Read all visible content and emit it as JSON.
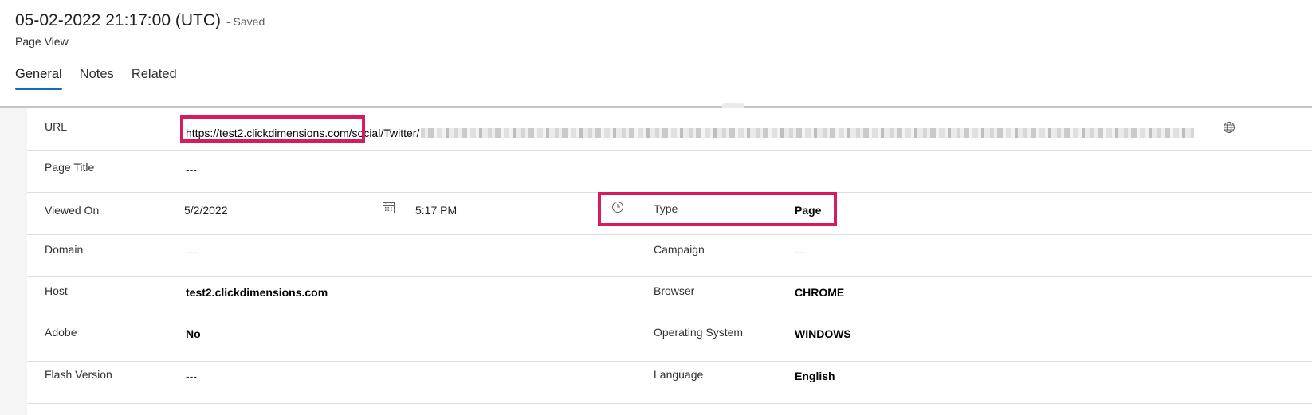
{
  "header": {
    "title": "05-02-2022 21:17:00 (UTC)",
    "saved_status": "- Saved",
    "entity_type": "Page View"
  },
  "tabs": [
    {
      "label": "General",
      "active": true
    },
    {
      "label": "Notes",
      "active": false
    },
    {
      "label": "Related",
      "active": false
    }
  ],
  "fields": {
    "url": {
      "label": "URL",
      "value": "https://test2.clickdimensions.com/social/Twitter/",
      "visible_prefix": "https://test2.clickdimensions.com/",
      "visible_suffix": "social/Twitter/"
    },
    "page_title": {
      "label": "Page Title",
      "value": "---"
    },
    "viewed_on": {
      "label": "Viewed On",
      "date": "5/2/2022",
      "time": "5:17 PM"
    },
    "type": {
      "label": "Type",
      "value": "Page"
    },
    "domain": {
      "label": "Domain",
      "value": "---"
    },
    "campaign": {
      "label": "Campaign",
      "value": "---"
    },
    "host": {
      "label": "Host",
      "value": "test2.clickdimensions.com"
    },
    "browser": {
      "label": "Browser",
      "value": "CHROME"
    },
    "adobe": {
      "label": "Adobe",
      "value": "No"
    },
    "operating_system": {
      "label": "Operating System",
      "value": "WINDOWS"
    },
    "flash_version": {
      "label": "Flash Version",
      "value": "---"
    },
    "language": {
      "label": "Language",
      "value": "English"
    }
  },
  "icons": {
    "url_action": "globe-icon",
    "date_picker": "calendar-icon",
    "time_picker": "clock-icon"
  },
  "colors": {
    "highlight": "#d81b60",
    "tab_underline": "#0f6cbd",
    "divider": "#c8c6c4"
  }
}
